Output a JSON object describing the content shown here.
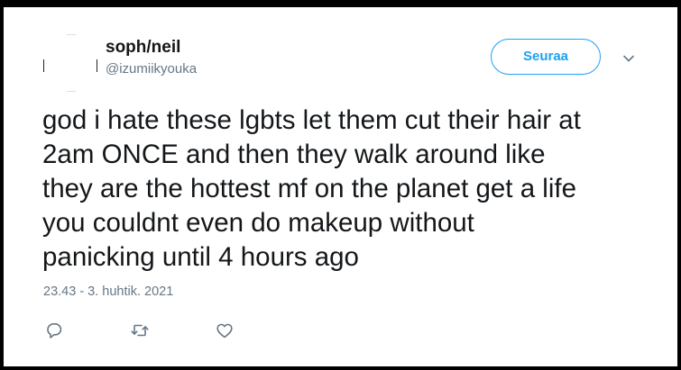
{
  "tweet": {
    "author": {
      "display_name": "soph/neil",
      "handle": "@izumiikyouka"
    },
    "follow_button_label": "Seuraa",
    "text_lines": [
      "god i hate these lgbts let them cut their hair at",
      "2am ONCE and then they walk around like",
      "they are the hottest mf on the planet get a life",
      "you couldnt even do makeup without",
      "panicking until 4 hours ago"
    ],
    "timestamp": "23.43 - 3. huhtik. 2021",
    "actions": [
      {
        "name": "reply",
        "icon": "reply-icon"
      },
      {
        "name": "retweet",
        "icon": "retweet-icon"
      },
      {
        "name": "like",
        "icon": "heart-icon"
      }
    ]
  },
  "colors": {
    "accent": "#1da1f2",
    "text": "#14171a",
    "secondary_text": "#657786",
    "icon": "#657786",
    "frame_border": "#000000",
    "background": "#ffffff"
  }
}
